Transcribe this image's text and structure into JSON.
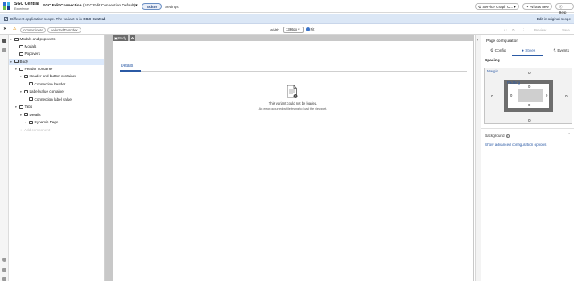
{
  "header": {
    "brand_title": "SGC Central",
    "brand_subtitle": "Experience",
    "app_title_bold": "SGC Edit Connection",
    "app_title_rest": " (SGC Edit Connection Default)",
    "app_title_caret": "▾",
    "tab_editor": "Editor",
    "tab_settings": "Settings",
    "scope_select": "Service Graph C... ▾",
    "whats_new": "What's new",
    "help": "Help"
  },
  "infobar": {
    "message": "Different application scope. The variant is in ",
    "message_bold": "SGC Central",
    "message_end": ".",
    "edit_link": "Edit in original scope"
  },
  "toolbar": {
    "param1": "connectionId",
    "param2": "selectedTabIndex",
    "width_label": "Width",
    "width_value": "1366px ▾",
    "fit_label": "Fit",
    "preview": "Preview",
    "save": "Save"
  },
  "tree": {
    "items": [
      {
        "label": "Modals and popovers",
        "caret": "▾"
      },
      {
        "label": "Modals",
        "caret": ""
      },
      {
        "label": "Popovers",
        "caret": ""
      },
      {
        "label": "Body",
        "caret": "▾"
      },
      {
        "label": "Header container",
        "caret": "▾"
      },
      {
        "label": "Header and button container",
        "caret": "▾"
      },
      {
        "label": "Connection header",
        "caret": ""
      },
      {
        "label": "Label value container",
        "caret": "▾"
      },
      {
        "label": "Connection label value",
        "caret": ""
      },
      {
        "label": "Tabs",
        "caret": "▾"
      },
      {
        "label": "Details",
        "caret": "▾"
      },
      {
        "label": "Dynamic Page",
        "caret": "›"
      },
      {
        "label": "Add component",
        "caret": "+"
      }
    ]
  },
  "canvas": {
    "body_tag": "Body",
    "details_tab": "Details",
    "error_title": "This variant could not be loaded.",
    "error_detail": "An error occurred while trying to load the viewport."
  },
  "config": {
    "title": "Page configuration",
    "tab_config": "Config",
    "tab_styles": "Styles",
    "tab_events": "Events",
    "spacing": "Spacing",
    "margin_label": "Margin",
    "padding_label": "Padding",
    "margin_top": "0",
    "margin_bottom": "0",
    "margin_left": "0",
    "margin_right": "0",
    "padding_top": "0",
    "padding_bottom": "0",
    "padding_left": "0",
    "padding_right": "0",
    "background_label": "Background",
    "advanced_link": "Show advanced configuration options"
  },
  "colors": {
    "accent": "#2b5aa5",
    "info_bar": "#dbe7f6",
    "canvas_bg": "#c8c8c8"
  }
}
